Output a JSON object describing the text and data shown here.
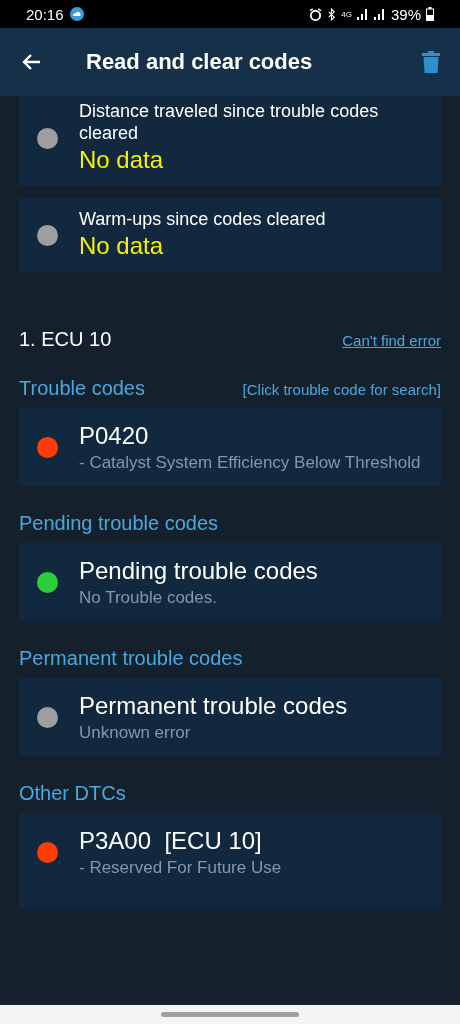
{
  "status_bar": {
    "time": "20:16",
    "network": "4G",
    "battery": "39%"
  },
  "app_bar": {
    "title": "Read and clear codes"
  },
  "readiness_cards": [
    {
      "label": "Distance traveled since trouble codes cleared",
      "value": "No data",
      "color": "#9e9e9e"
    },
    {
      "label": "Warm-ups since codes cleared",
      "value": "No data",
      "color": "#9e9e9e"
    }
  ],
  "ecu": {
    "title": "1. ECU 10",
    "link": "Can't find error"
  },
  "sections": [
    {
      "title": "Trouble codes",
      "hint": "[Click trouble code for search]",
      "items": [
        {
          "code": "P0420",
          "description": "- Catalyst System Efficiency Below Threshold",
          "color": "#ff3d00"
        }
      ]
    },
    {
      "title": "Pending trouble codes",
      "items": [
        {
          "code": "Pending trouble codes",
          "description": "No Trouble codes.",
          "color": "#2fcc3a"
        }
      ]
    },
    {
      "title": "Permanent trouble codes",
      "items": [
        {
          "code": "Permanent trouble codes",
          "description": "Unknown error",
          "color": "#9e9e9e"
        }
      ]
    },
    {
      "title": "Other DTCs",
      "items": [
        {
          "code": "P3A00  [ECU 10]",
          "description": "- Reserved For Future Use",
          "color": "#ff3d00"
        }
      ]
    }
  ]
}
